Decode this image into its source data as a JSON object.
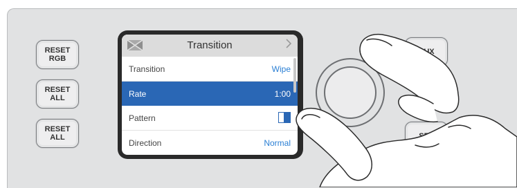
{
  "buttons": {
    "reset_rgb": "RESET\nRGB",
    "reset_all_1": "RESET\nALL",
    "reset_all_2": "RESET\nALL",
    "aux": "AUX",
    "set": "SET"
  },
  "lcd": {
    "title": "Transition",
    "header_icon": "wipe-icon",
    "nav_icon": "chevron-right-icon",
    "rows": [
      {
        "label": "Transition",
        "value": "Wipe"
      },
      {
        "label": "Rate",
        "value": "1:00",
        "selected": true
      },
      {
        "label": "Pattern",
        "value_icon": "pattern-swatch-icon"
      },
      {
        "label": "Direction",
        "value": "Normal"
      }
    ]
  },
  "colors": {
    "panel": "#e1e2e3",
    "selection": "#2a67b5",
    "value_text": "#2a7fd4"
  }
}
